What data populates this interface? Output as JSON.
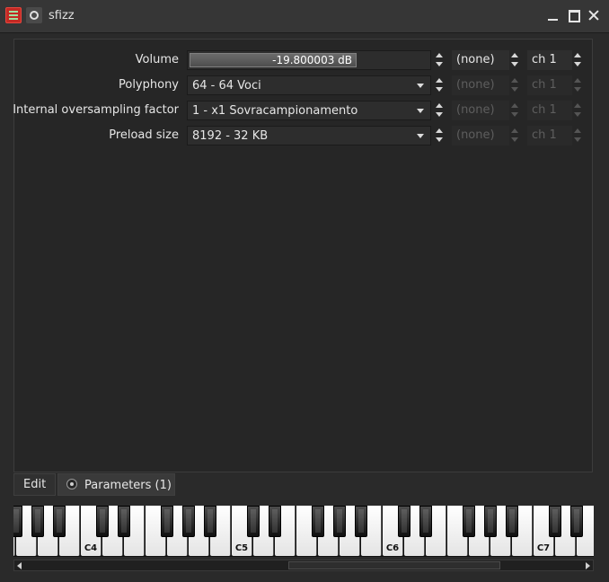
{
  "window": {
    "title": "sfizz"
  },
  "icons": {
    "app": "sfizz-app-icon",
    "pin": "pin-icon",
    "minimize": "minimize-icon",
    "maximize": "maximize-icon",
    "close": "close-icon"
  },
  "parameters": [
    {
      "label": "Volume",
      "value": "-19.800003 dB",
      "cc": "(none)",
      "channel": "ch 1",
      "enabled": true
    },
    {
      "label": "Polyphony",
      "value": "64 - 64 Voci",
      "cc": "(none)",
      "channel": "ch 1",
      "enabled": false
    },
    {
      "label": "Internal oversampling factor",
      "value": "1 - x1 Sovracampionamento",
      "cc": "(none)",
      "channel": "ch 1",
      "enabled": false
    },
    {
      "label": "Preload size",
      "value": "8192 - 32 KB",
      "cc": "(none)",
      "channel": "ch 1",
      "enabled": false
    }
  ],
  "volume_level": 0.7,
  "tabs": {
    "edit": "Edit",
    "parameters": "Parameters (1)"
  },
  "piano": {
    "octave_labels": [
      "C4",
      "C5",
      "C6",
      "C7"
    ]
  },
  "colors": {
    "background": "#2a2a2a",
    "panel": "#262626",
    "app_icon": "#c32a24"
  }
}
